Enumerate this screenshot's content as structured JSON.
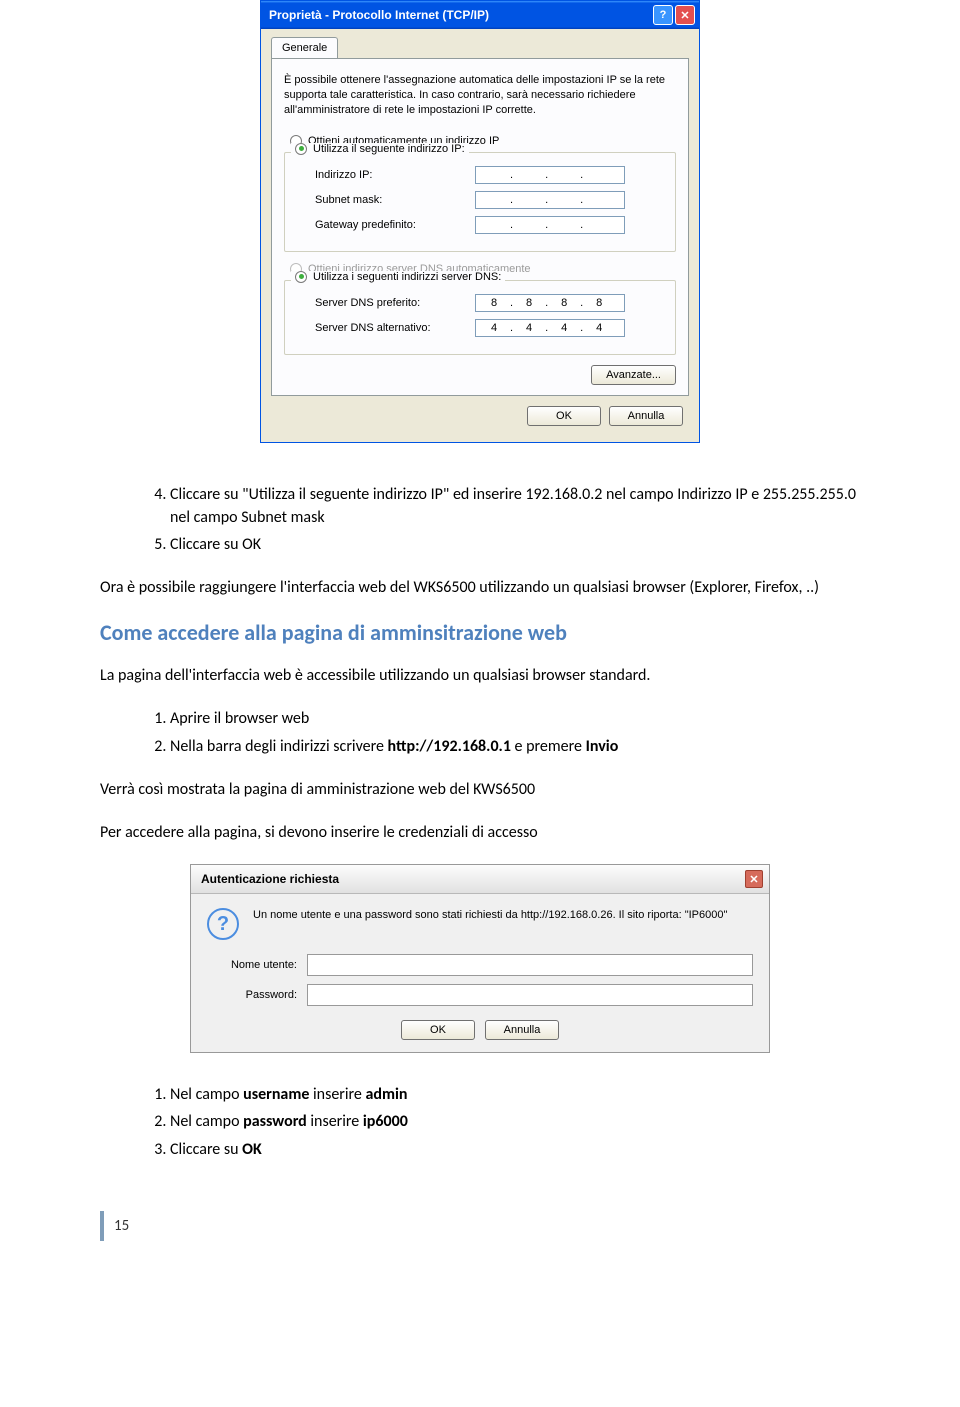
{
  "tcpip_dialog": {
    "title": "Proprietà - Protocollo Internet (TCP/IP)",
    "tab": "Generale",
    "description": "È possibile ottenere l'assegnazione automatica delle impostazioni IP se la rete supporta tale caratteristica. In caso contrario, sarà necessario richiedere all'amministratore di rete le impostazioni IP corrette.",
    "radio_auto_ip": "Ottieni automaticamente un indirizzo IP",
    "radio_manual_ip": "Utilizza il seguente indirizzo IP:",
    "label_ip": "Indirizzo IP:",
    "label_subnet": "Subnet mask:",
    "label_gateway": "Gateway predefinito:",
    "radio_auto_dns": "Ottieni indirizzo server DNS automaticamente",
    "radio_manual_dns": "Utilizza i seguenti indirizzi server DNS:",
    "label_dns1": "Server DNS preferito:",
    "label_dns2": "Server DNS alternativo:",
    "dns1": [
      "8",
      "8",
      "8",
      "8"
    ],
    "dns2": [
      "4",
      "4",
      "4",
      "4"
    ],
    "btn_advanced": "Avanzate...",
    "btn_ok": "OK",
    "btn_cancel": "Annulla"
  },
  "doc": {
    "step4": "Cliccare su \"Utilizza il seguente indirizzo IP\" ed inserire 192.168.0.2 nel campo Indirizzo IP e 255.255.255.0 nel campo Subnet mask",
    "step4_num": "4.",
    "step5_num": "5.",
    "step5": "Cliccare su OK",
    "after_steps": "Ora è possibile raggiungere l'interfaccia web del WKS6500 utilizzando un qualsiasi browser (Explorer, Firefox, ..)",
    "h2": "Come accedere alla pagina di amminsitrazione web",
    "para2": "La pagina dell'interfaccia web è accessibile utilizzando un qualsiasi browser standard.",
    "step_a1_num": "1.",
    "step_a1": "Aprire il browser web",
    "step_a2_num": "2.",
    "step_a2_pre": "Nella barra degli indirizzi scrivere ",
    "step_a2_url": "http://192.168.0.1",
    "step_a2_post": " e premere ",
    "step_a2_key": "Invio",
    "para3": "Verrà così mostrata la pagina di amministrazione web del KWS6500",
    "para4": "Per accedere alla pagina, si devono inserire le credenziali di accesso",
    "step_b1_num": "1.",
    "step_b1_pre": "Nel campo ",
    "step_b1_field": "username",
    "step_b1_mid": " inserire ",
    "step_b1_val": "admin",
    "step_b2_num": "2.",
    "step_b2_pre": "Nel campo ",
    "step_b2_field": "password",
    "step_b2_mid": " inserire ",
    "step_b2_val": "ip6000",
    "step_b3_num": "3.",
    "step_b3": "Cliccare su ",
    "step_b3_btn": "OK",
    "page_number": "15"
  },
  "auth_dialog": {
    "title": "Autenticazione richiesta",
    "message": "Un nome utente e una password sono stati richiesti da http://192.168.0.26. Il sito riporta: \"IP6000\"",
    "label_user": "Nome utente:",
    "label_pass": "Password:",
    "btn_ok": "OK",
    "btn_cancel": "Annulla"
  }
}
